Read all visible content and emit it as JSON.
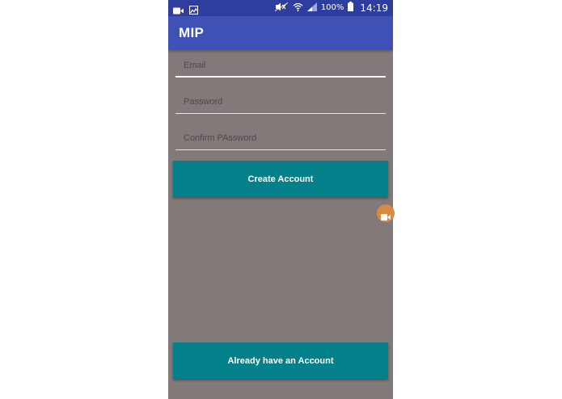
{
  "status_bar": {
    "battery_percent": "100%",
    "time": "14:19",
    "icons": [
      "video-camera-icon",
      "image-icon",
      "mute-icon",
      "wifi-icon",
      "signal-icon",
      "battery-icon"
    ]
  },
  "app_bar": {
    "title": "MIP"
  },
  "form": {
    "email_placeholder": "Email",
    "password_placeholder": "Password",
    "confirm_password_placeholder": "Confirm PAssword",
    "create_account_label": "Create Account",
    "already_have_account_label": "Already have an Account"
  },
  "colors": {
    "status_bar": "#2f3e9e",
    "app_bar": "#3f51b5",
    "background": "#827a79",
    "button": "#038089",
    "floating_bubble": "#d88a3f"
  },
  "floating_bubble": {
    "icon": "video-camera-icon"
  }
}
